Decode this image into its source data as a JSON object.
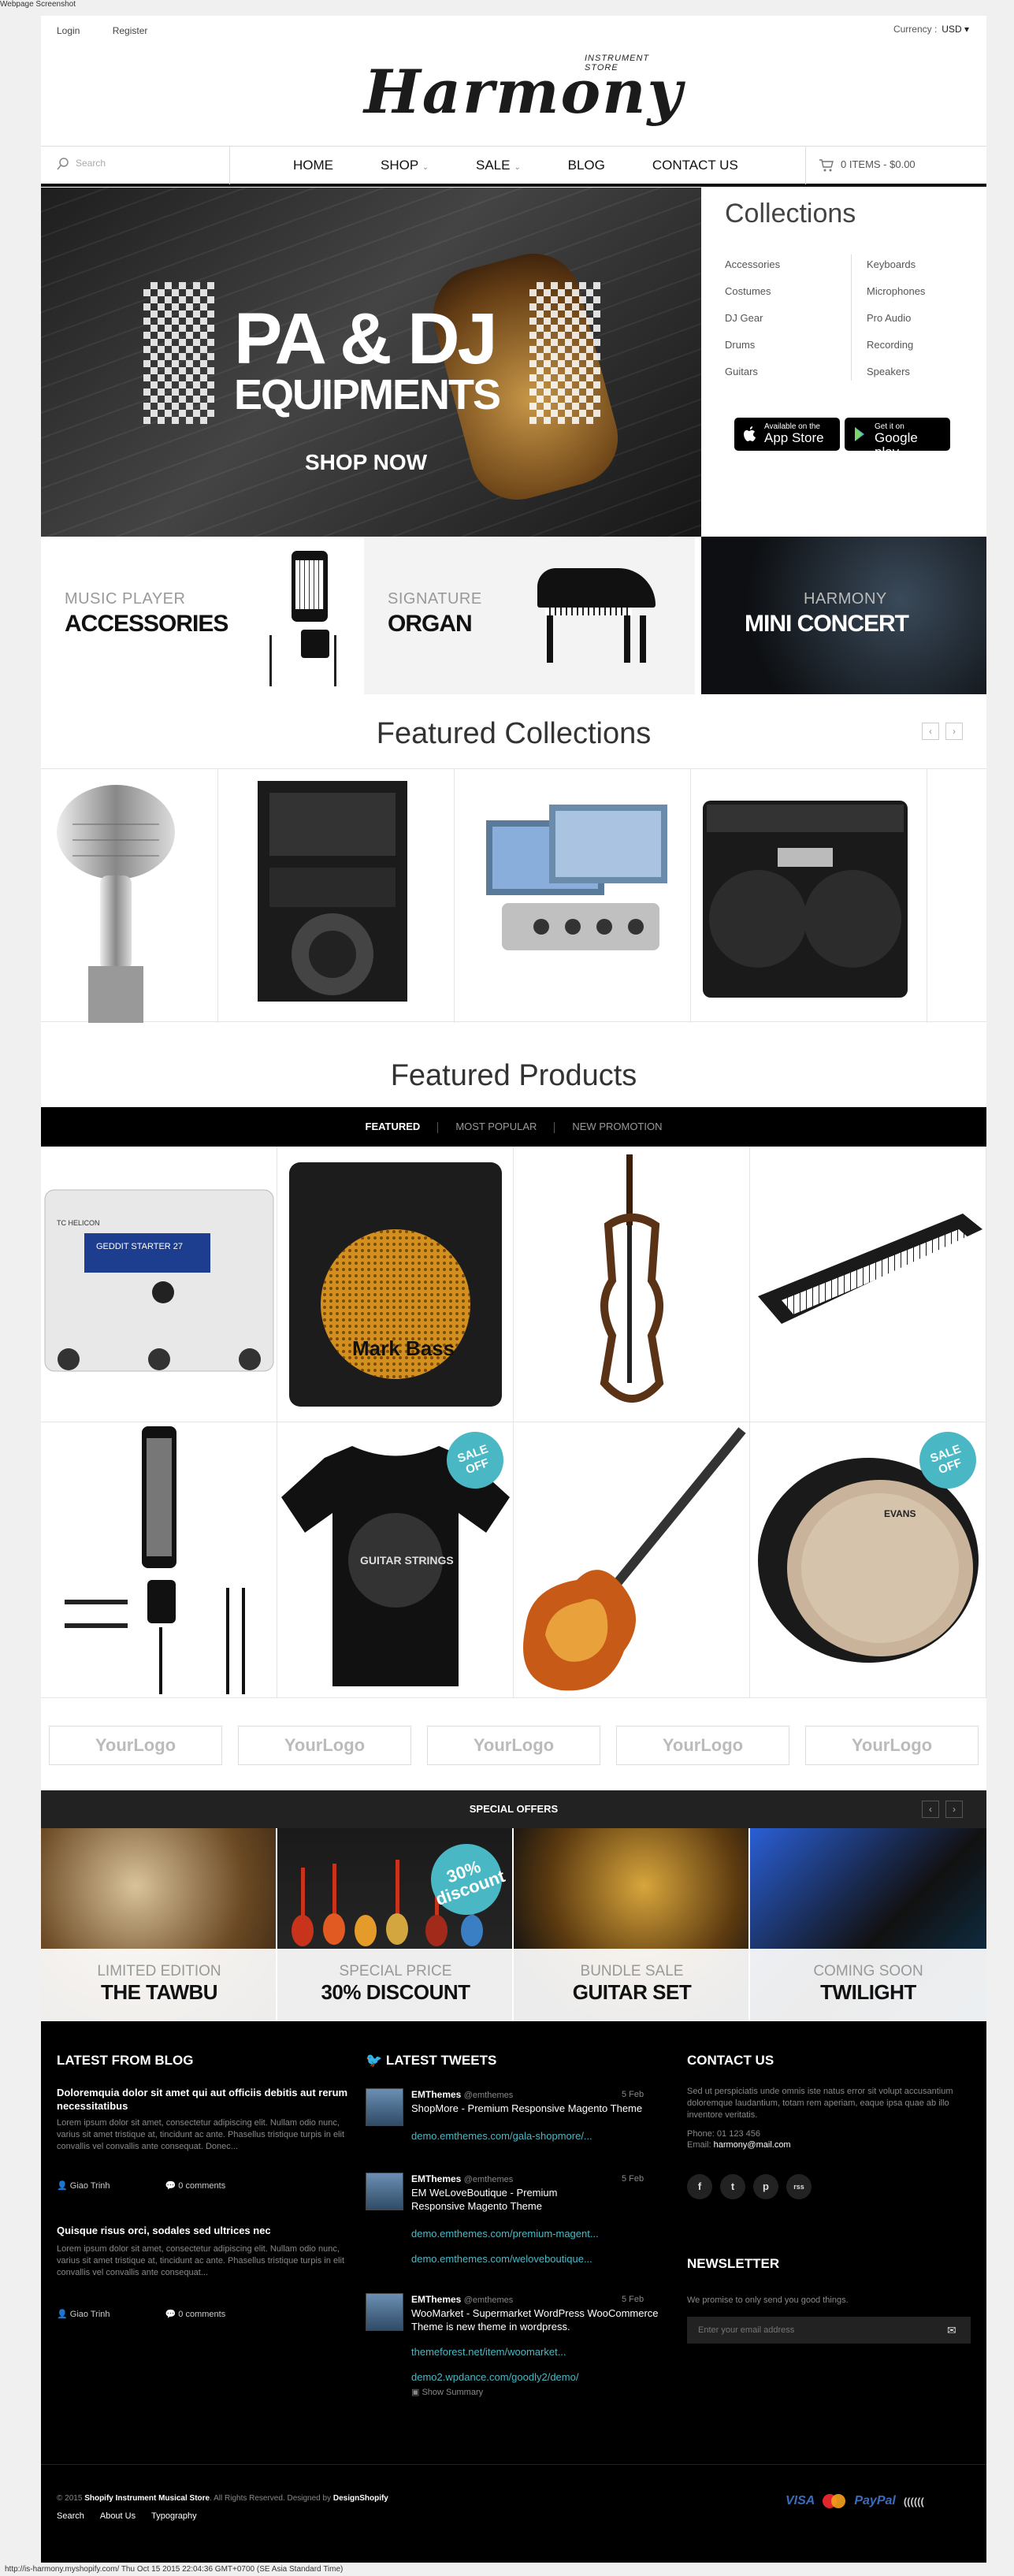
{
  "caption_top": "Webpage Screenshot",
  "caption_bottom": "http://is-harmony.myshopify.com/ Thu Oct 15 2015 22:04:36 GMT+0700 (SE Asia Standard Time)",
  "header": {
    "login": "Login",
    "register": "Register",
    "currency_label": "Currency :",
    "currency_value": "USD ▾",
    "logo_text": "Harmony",
    "logo_tagline": "INSTRUMENT STORE"
  },
  "nav": {
    "search_placeholder": "Search",
    "items": [
      "HOME",
      "SHOP",
      "SALE",
      "BLOG",
      "CONTACT US"
    ],
    "cart": "0 ITEMS - $0.00"
  },
  "hero": {
    "line1": "PA & DJ",
    "line2": "EQUIPMENTS",
    "cta": "SHOP NOW"
  },
  "collections": {
    "title": "Collections",
    "left": [
      "Accessories",
      "Costumes",
      "DJ Gear",
      "Drums",
      "Guitars"
    ],
    "right": [
      "Keyboards",
      "Microphones",
      "Pro Audio",
      "Recording",
      "Speakers"
    ],
    "appstore_small": "Available on the",
    "appstore_big": "App Store",
    "gplay_small": "Get it on",
    "gplay_big": "Google play"
  },
  "banners": [
    {
      "small": "MUSIC PLAYER",
      "large": "ACCESSORIES"
    },
    {
      "small": "SIGNATURE",
      "large": "ORGAN"
    },
    {
      "small": "HARMONY",
      "large": "MINI CONCERT"
    }
  ],
  "featured_collections_title": "Featured Collections",
  "featured_products_title": "Featured Products",
  "tabs": [
    "FEATURED",
    "MOST POPULAR",
    "NEW PROMOTION"
  ],
  "product_badges": [
    "SALE OFF",
    "SALE OFF"
  ],
  "product_texts": {
    "pedal_brand": "TC HELICON",
    "pedal_screen": "GEDDIT STARTER 27",
    "amp_brand": "Mark Bass",
    "drum_brand": "EVANS",
    "shirt_text": "GUITAR STRINGS"
  },
  "logos": [
    "YourLogo",
    "YourLogo",
    "YourLogo",
    "YourLogo",
    "YourLogo"
  ],
  "special_offers": {
    "title": "SPECIAL OFFERS",
    "badge": "30% discount",
    "items": [
      {
        "small": "LIMITED EDITION",
        "large": "THE TAWBU"
      },
      {
        "small": "SPECIAL PRICE",
        "large": "30% DISCOUNT"
      },
      {
        "small": "BUNDLE SALE",
        "large": "GUITAR SET"
      },
      {
        "small": "COMING SOON",
        "large": "TWILIGHT"
      }
    ]
  },
  "footer": {
    "blog_title": "LATEST FROM BLOG",
    "posts": [
      {
        "title": "Doloremquia dolor sit amet qui aut officiis debitis aut rerum necessitatibus",
        "excerpt": "Lorem ipsum dolor sit amet, consectetur adipiscing elit. Nullam odio nunc, varius sit amet tristique at, tincidunt ac ante. Phasellus tristique turpis in elit convallis vel convallis ante consequat. Donec...",
        "author": "Giao Trinh",
        "comments": "0 comments"
      },
      {
        "title": "Quisque risus orci, sodales sed ultrices nec",
        "excerpt": "Lorem ipsum dolor sit amet, consectetur adipiscing elit. Nullam odio nunc, varius sit amet tristique at, tincidunt ac ante. Phasellus tristique turpis in elit convallis vel convallis ante consequat...",
        "author": "Giao Trinh",
        "comments": "0 comments"
      }
    ],
    "tweets_title": "LATEST TWEETS",
    "tweets": [
      {
        "name": "EMThemes",
        "handle": "@emthemes",
        "date": "5 Feb",
        "text": "ShopMore - Premium Responsive Magento Theme",
        "links": [
          "demo.emthemes.com/gala-shopmore/..."
        ]
      },
      {
        "name": "EMThemes",
        "handle": "@emthemes",
        "date": "5 Feb",
        "text": "EM WeLoveBoutique - Premium Responsive Magento Theme",
        "links": [
          "demo.emthemes.com/premium-magent...",
          "demo.emthemes.com/weloveboutique..."
        ]
      },
      {
        "name": "EMThemes",
        "handle": "@emthemes",
        "date": "5 Feb",
        "text": "WooMarket - Supermarket WordPress WooCommerce Theme is new theme in wordpress.",
        "links": [
          "themeforest.net/item/woomarket...",
          "demo2.wpdance.com/goodly2/demo/"
        ]
      }
    ],
    "show_summary": "Show Summary",
    "contact_title": "CONTACT US",
    "contact_text": "Sed ut perspiciatis unde omnis iste natus error sit volupt accusantium doloremque laudantium, totam rem aperiam, eaque ipsa quae ab illo inventore veritatis.",
    "phone": "Phone: 01 123 456",
    "email_label": "Email:",
    "email": "harmony@mail.com",
    "social": [
      "f",
      "t",
      "p",
      "rss"
    ],
    "newsletter_title": "NEWSLETTER",
    "newsletter_text": "We promise to only send you good things.",
    "newsletter_placeholder": "Enter your email address",
    "copyright_pre": "© 2015",
    "copyright_store": "Shopify Instrument Musical Store",
    "copyright_mid": ". All Rights Reserved. Designed by",
    "copyright_designer": "DesignShopify",
    "links": [
      "Search",
      "About Us",
      "Typography"
    ],
    "payments": [
      "VISA",
      "MC",
      "PayPal",
      "(((((("
    ]
  },
  "colors": {
    "accent": "#4ab8c4",
    "black": "#000000",
    "link": "#4ab8c4"
  }
}
